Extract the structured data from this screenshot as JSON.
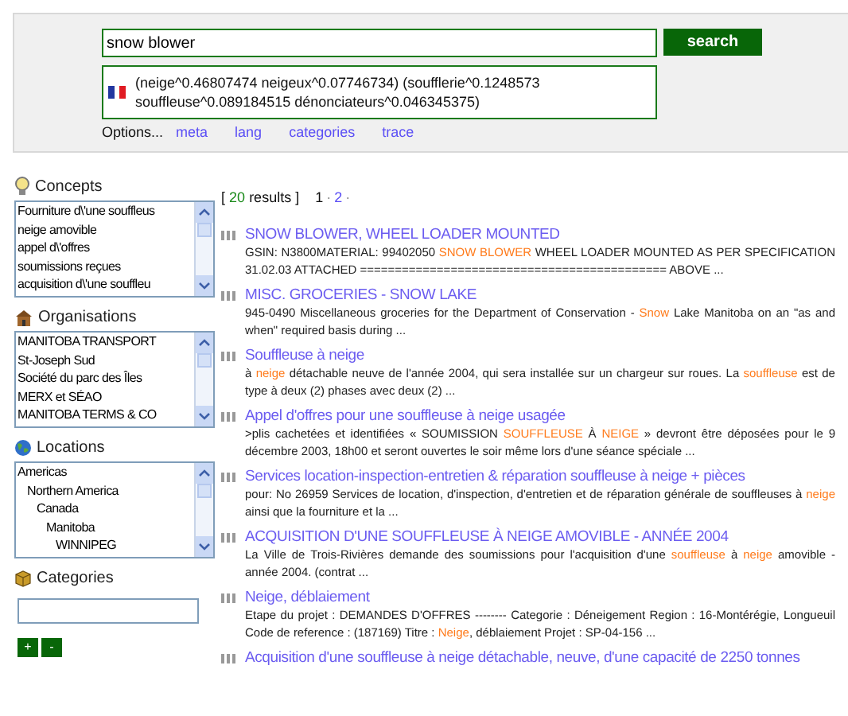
{
  "search": {
    "value": "snow blower",
    "button": "search"
  },
  "query_expansion": "(neige^0.46807474 neigeux^0.07746734) (soufflerie^0.1248573 souffleuse^0.089184515 dénonciateurs^0.046345375)",
  "options": {
    "label": "Options...",
    "links": [
      "meta",
      "lang",
      "categories",
      "trace"
    ]
  },
  "sidebar": [
    {
      "kind": "list",
      "title": "Concepts",
      "items": [
        {
          "text": "Fourniture d\\'une souffleus"
        },
        {
          "text": "neige amovible"
        },
        {
          "text": "appel d\\'offres"
        },
        {
          "text": "soumissions reçues"
        },
        {
          "text": "acquisition d\\'une souffleu"
        }
      ]
    },
    {
      "kind": "list",
      "title": "Organisations",
      "items": [
        {
          "text": "MANITOBA TRANSPORT"
        },
        {
          "text": "St-Joseph Sud"
        },
        {
          "text": "Société du parc des Îles"
        },
        {
          "text": "MERX et SÉAO"
        },
        {
          "text": "MANITOBA TERMS & CO"
        }
      ]
    },
    {
      "kind": "tree",
      "title": "Locations",
      "items": [
        {
          "text": "Americas",
          "children": [
            {
              "text": "Northern America",
              "children": [
                {
                  "text": "Canada",
                  "children": [
                    {
                      "text": "Manitoba",
                      "children": [
                        {
                          "text": "WINNIPEG"
                        }
                      ]
                    }
                  ]
                }
              ]
            }
          ]
        }
      ]
    },
    {
      "kind": "field",
      "title": "Categories"
    }
  ],
  "category_buttons": [
    "+",
    "-"
  ],
  "results_summary": {
    "open": "[",
    "count": "20",
    "label": "results ]",
    "pages": [
      {
        "label": "1",
        "selected": true
      },
      {
        "label": "2",
        "selected": false
      }
    ],
    "separator": "·"
  },
  "results": [
    {
      "title": "SNOW BLOWER, WHEEL LOADER MOUNTED",
      "snippet": [
        {
          "text": "GSIN: N3800MATERIAL: 99402050 ",
          "highlight": false
        },
        {
          "text": "SNOW BLOWER",
          "highlight": true
        },
        {
          "text": " WHEEL LOADER MOUNTED AS PER SPECIFICATION 31.02.03 ATTACHED ============================================ ABOVE ...",
          "highlight": false
        }
      ]
    },
    {
      "title": "MISC. GROCERIES - SNOW LAKE",
      "snippet": [
        {
          "text": "945-0490 Miscellaneous groceries for the Department of Conservation - ",
          "highlight": false
        },
        {
          "text": "Snow",
          "highlight": true
        },
        {
          "text": " Lake Manitoba on an \"as and when\" required basis during ...",
          "highlight": false
        }
      ]
    },
    {
      "title": "Souffleuse à neige",
      "snippet": [
        {
          "text": "à ",
          "highlight": false
        },
        {
          "text": "neige",
          "highlight": true
        },
        {
          "text": " détachable neuve de l'année 2004, qui sera installée sur un chargeur sur roues. La ",
          "highlight": false
        },
        {
          "text": "souffleuse",
          "highlight": true
        },
        {
          "text": " est de type à deux (2) phases avec deux (2) ...",
          "highlight": false
        }
      ]
    },
    {
      "title": "Appel d'offres pour une souffleuse à neige usagée",
      "snippet": [
        {
          "text": ">plis cachetées et identifiées « SOUMISSION ",
          "highlight": false
        },
        {
          "text": "SOUFFLEUSE",
          "highlight": true
        },
        {
          "text": " À ",
          "highlight": false
        },
        {
          "text": "NEIGE",
          "highlight": true
        },
        {
          "text": " » devront être déposées pour le 9 décembre 2003, 18h00 et seront ouvertes le soir même lors d'une séance spéciale ...",
          "highlight": false
        }
      ]
    },
    {
      "title": "Services location-inspection-entretien & réparation souffleuse à neige + pièces",
      "snippet": [
        {
          "text": "pour: No 26959 Services de location, d'inspection, d'entretien et de réparation générale de souffleuses à ",
          "highlight": false
        },
        {
          "text": "neige",
          "highlight": true
        },
        {
          "text": " ainsi que la fourniture et la ...",
          "highlight": false
        }
      ]
    },
    {
      "title": "ACQUISITION D'UNE SOUFFLEUSE À NEIGE AMOVIBLE - ANNÉE 2004",
      "snippet": [
        {
          "text": "La Ville de Trois-Rivières demande des soumissions pour l'acquisition d'une ",
          "highlight": false
        },
        {
          "text": "souffleuse",
          "highlight": true
        },
        {
          "text": " à ",
          "highlight": false
        },
        {
          "text": "neige",
          "highlight": true
        },
        {
          "text": " amovible - année 2004. (contrat ...",
          "highlight": false
        }
      ]
    },
    {
      "title": "Neige, déblaiement",
      "snippet": [
        {
          "text": "Etape du projet : DEMANDES D'OFFRES -------- Categorie : Déneigement Region : 16-Montérégie, Longueuil Code de reference : (187169) Titre : ",
          "highlight": false
        },
        {
          "text": "Neige",
          "highlight": true
        },
        {
          "text": ", déblaiement Projet : SP-04-156 ...",
          "highlight": false
        }
      ]
    },
    {
      "title": "Acquisition d'une souffleuse à neige détachable, neuve, d'une capacité de 2250 tonnes"
    }
  ]
}
